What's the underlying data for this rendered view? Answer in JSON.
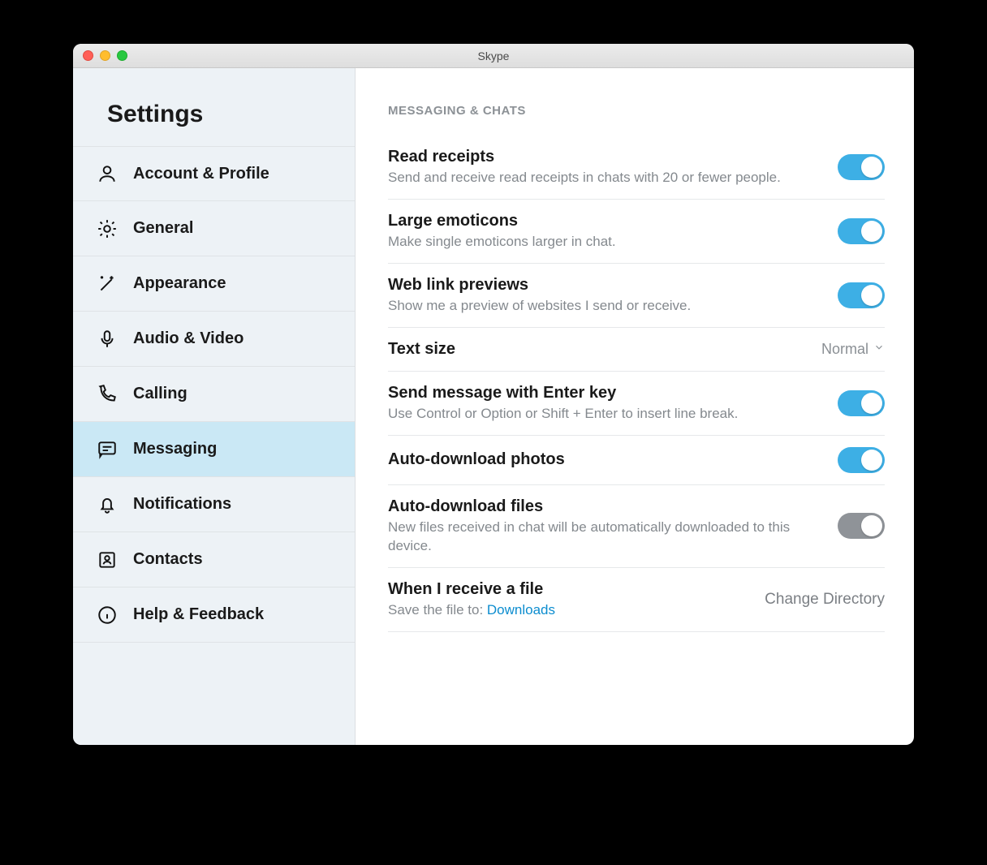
{
  "window": {
    "title": "Skype"
  },
  "sidebar": {
    "heading": "Settings",
    "items": [
      {
        "id": "account",
        "label": "Account & Profile"
      },
      {
        "id": "general",
        "label": "General"
      },
      {
        "id": "appearance",
        "label": "Appearance"
      },
      {
        "id": "audiovideo",
        "label": "Audio & Video"
      },
      {
        "id": "calling",
        "label": "Calling"
      },
      {
        "id": "messaging",
        "label": "Messaging",
        "active": true
      },
      {
        "id": "notifications",
        "label": "Notifications"
      },
      {
        "id": "contacts",
        "label": "Contacts"
      },
      {
        "id": "help",
        "label": "Help & Feedback"
      }
    ]
  },
  "content": {
    "sectionHeader": "MESSAGING & CHATS",
    "rows": {
      "readReceipts": {
        "title": "Read receipts",
        "desc": "Send and receive read receipts in chats with 20 or fewer people.",
        "on": true
      },
      "largeEmoticons": {
        "title": "Large emoticons",
        "desc": "Make single emoticons larger in chat.",
        "on": true
      },
      "webLinkPreviews": {
        "title": "Web link previews",
        "desc": "Show me a preview of websites I send or receive.",
        "on": true
      },
      "textSize": {
        "title": "Text size",
        "value": "Normal"
      },
      "sendWithEnter": {
        "title": "Send message with Enter key",
        "desc": "Use Control or Option or Shift + Enter to insert line break.",
        "on": true
      },
      "autoPhotos": {
        "title": "Auto-download photos",
        "on": true
      },
      "autoFiles": {
        "title": "Auto-download files",
        "desc": "New files received in chat will be automatically downloaded to this device.",
        "on": false
      },
      "receiveFile": {
        "title": "When I receive a file",
        "descPrefix": "Save the file to: ",
        "descLink": "Downloads",
        "action": "Change Directory"
      }
    }
  }
}
